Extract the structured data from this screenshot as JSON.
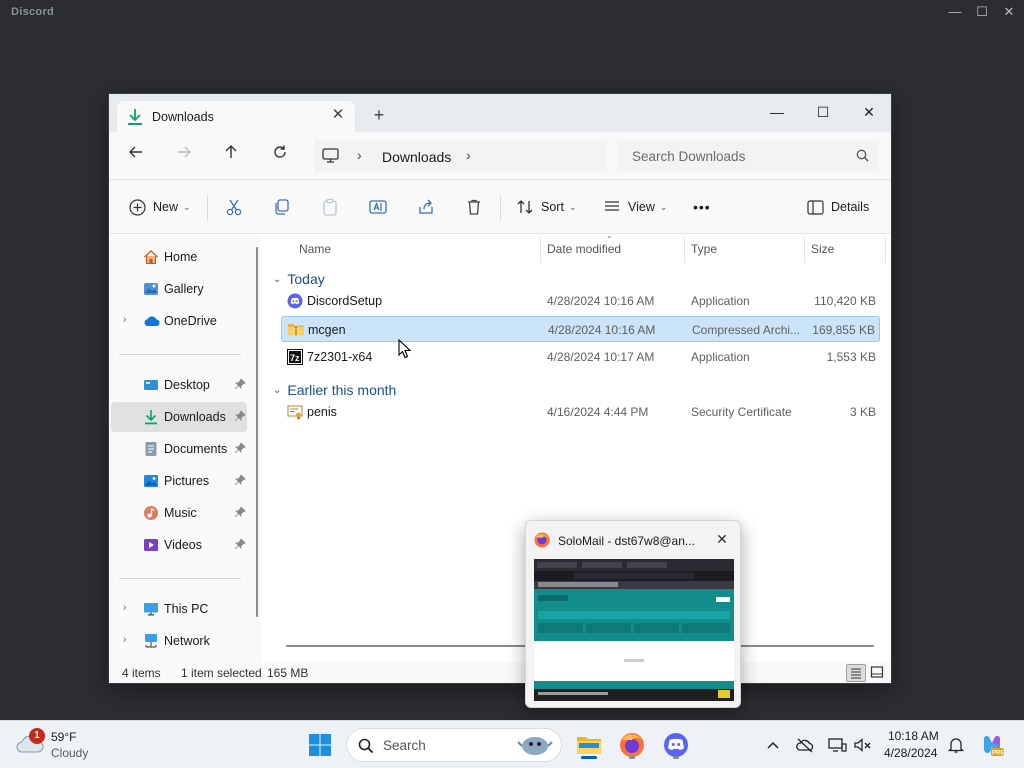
{
  "background_app": {
    "title": "Discord",
    "controls": {
      "minimize": "—",
      "maximize": "☐",
      "close": "✕"
    }
  },
  "explorer": {
    "tab": {
      "label": "Downloads",
      "close": "✕"
    },
    "new_tab": "+",
    "window_controls": {
      "minimize": "—",
      "maximize": "☐",
      "close": "✕"
    },
    "breadcrumb": {
      "location": "Downloads",
      "separator": "›"
    },
    "search": {
      "placeholder": "Search Downloads"
    },
    "commands": {
      "new": "New",
      "sort": "Sort",
      "view": "View",
      "more": "•••",
      "details": "Details"
    },
    "sidebar": {
      "items": [
        {
          "label": "Home",
          "icon": "home-icon"
        },
        {
          "label": "Gallery",
          "icon": "gallery-icon"
        },
        {
          "label": "OneDrive",
          "icon": "onedrive-icon",
          "expandable": true
        },
        {
          "label": "Desktop",
          "icon": "desktop-icon",
          "pinned": true
        },
        {
          "label": "Downloads",
          "icon": "downloads-icon",
          "pinned": true,
          "selected": true
        },
        {
          "label": "Documents",
          "icon": "documents-icon",
          "pinned": true
        },
        {
          "label": "Pictures",
          "icon": "pictures-icon",
          "pinned": true
        },
        {
          "label": "Music",
          "icon": "music-icon",
          "pinned": true
        },
        {
          "label": "Videos",
          "icon": "videos-icon",
          "pinned": true
        },
        {
          "label": "This PC",
          "icon": "this-pc-icon",
          "expandable": true
        },
        {
          "label": "Network",
          "icon": "network-icon",
          "expandable": true
        }
      ]
    },
    "columns": {
      "name": "Name",
      "date": "Date modified",
      "type": "Type",
      "size": "Size"
    },
    "groups": [
      {
        "label": "Today",
        "files": [
          {
            "name": "DiscordSetup",
            "date": "4/28/2024 10:16 AM",
            "type": "Application",
            "size": "110,420 KB",
            "icon": "discord-app-icon"
          },
          {
            "name": "mcgen",
            "date": "4/28/2024 10:16 AM",
            "type": "Compressed Archi...",
            "size": "169,855 KB",
            "icon": "zip-folder-icon",
            "selected": true
          },
          {
            "name": "7z2301-x64",
            "date": "4/28/2024 10:17 AM",
            "type": "Application",
            "size": "1,553 KB",
            "icon": "7zip-icon"
          }
        ]
      },
      {
        "label": "Earlier this month",
        "files": [
          {
            "name": "penis",
            "date": "4/16/2024 4:44 PM",
            "type": "Security Certificate",
            "size": "3 KB",
            "icon": "certificate-icon"
          }
        ]
      }
    ],
    "status": {
      "count": "4 items",
      "selection": "1 item selected",
      "selection_size": "165 MB"
    }
  },
  "thumbnail": {
    "title": "SoloMail - dst67w8@an...",
    "close": "✕"
  },
  "taskbar": {
    "weather": {
      "temp": "59°F",
      "condition": "Cloudy",
      "badge": "1"
    },
    "search_label": "Search",
    "clock": {
      "time": "10:18 AM",
      "date": "4/28/2024"
    }
  },
  "colors": {
    "accent": "#005fb8",
    "selection": "#cce4f7",
    "group_header": "#1c4f8c",
    "discord": "#5865f2",
    "teal_preview": "#138c8c"
  }
}
